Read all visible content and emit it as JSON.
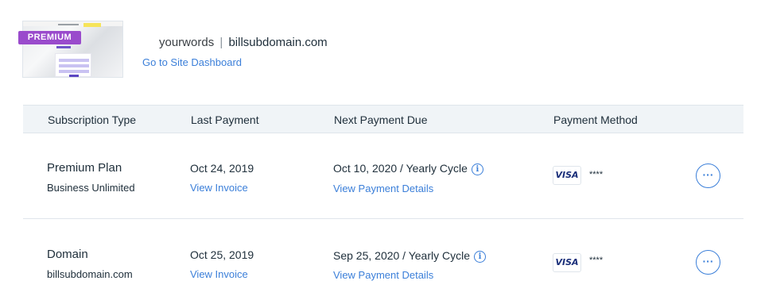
{
  "site": {
    "badge": "PREMIUM",
    "owner": "yourwords",
    "separator": "|",
    "domain": "billsubdomain.com",
    "dashboard_link": "Go to Site Dashboard"
  },
  "table": {
    "headers": [
      "Subscription Type",
      "Last Payment",
      "Next Payment Due",
      "Payment Method"
    ],
    "rows": [
      {
        "type": "Premium Plan",
        "detail": "Business Unlimited",
        "last_payment": "Oct 24, 2019",
        "invoice_link": "View Invoice",
        "next_due": "Oct 10, 2020 / Yearly Cycle",
        "details_link": "View Payment Details",
        "card_brand": "VISA",
        "card_masked": "****"
      },
      {
        "type": "Domain",
        "detail": "billsubdomain.com",
        "last_payment": "Oct 25, 2019",
        "invoice_link": "View Invoice",
        "next_due": "Sep 25, 2020 / Yearly Cycle",
        "details_link": "View Payment Details",
        "card_brand": "VISA",
        "card_masked": "****"
      }
    ]
  },
  "icons": {
    "info": "info-icon",
    "more": "more-options-icon"
  },
  "colors": {
    "accent": "#3b7fd9",
    "premium_badge": "#9a4bcc",
    "header_bg": "#f0f4f7"
  }
}
